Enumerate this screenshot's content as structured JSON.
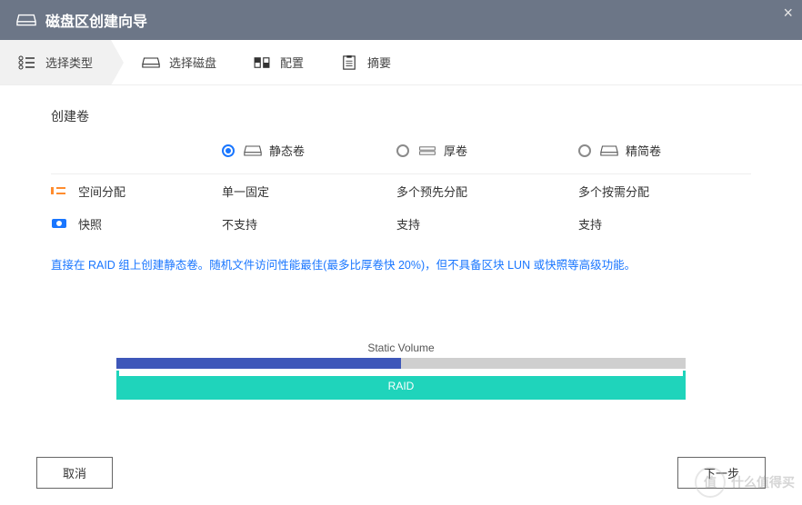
{
  "window": {
    "title": "磁盘区创建向导"
  },
  "steps": [
    {
      "label": "选择类型",
      "icon": "list-icon",
      "active": true
    },
    {
      "label": "选择磁盘",
      "icon": "disk-icon",
      "active": false
    },
    {
      "label": "配置",
      "icon": "config-icon",
      "active": false
    },
    {
      "label": "摘要",
      "icon": "summary-icon",
      "active": false
    }
  ],
  "section": {
    "title": "创建卷"
  },
  "volume_options": [
    {
      "key": "static",
      "label": "静态卷",
      "checked": true
    },
    {
      "key": "thick",
      "label": "厚卷",
      "checked": false
    },
    {
      "key": "thin",
      "label": "精简卷",
      "checked": false
    }
  ],
  "attributes": [
    {
      "icon": "space-icon",
      "label": "空间分配",
      "values": [
        "单一固定",
        "多个预先分配",
        "多个按需分配"
      ]
    },
    {
      "icon": "snapshot-icon",
      "label": "快照",
      "values": [
        "不支持",
        "支持",
        "支持"
      ]
    }
  ],
  "description": "直接在 RAID 组上创建静态卷。随机文件访问性能最佳(最多比厚卷快 20%)，但不具备区块 LUN 或快照等高级功能。",
  "diagram": {
    "static_volume_label": "Static Volume",
    "raid_label": "RAID",
    "fill_percent": 50
  },
  "buttons": {
    "cancel": "取消",
    "next": "下一步"
  },
  "watermark": {
    "badge": "值",
    "text": "什么值得买"
  },
  "colors": {
    "accent": "#1976ff",
    "titlebar": "#6c7687",
    "raid": "#1fd4bb",
    "static_fill": "#3e57b9"
  }
}
